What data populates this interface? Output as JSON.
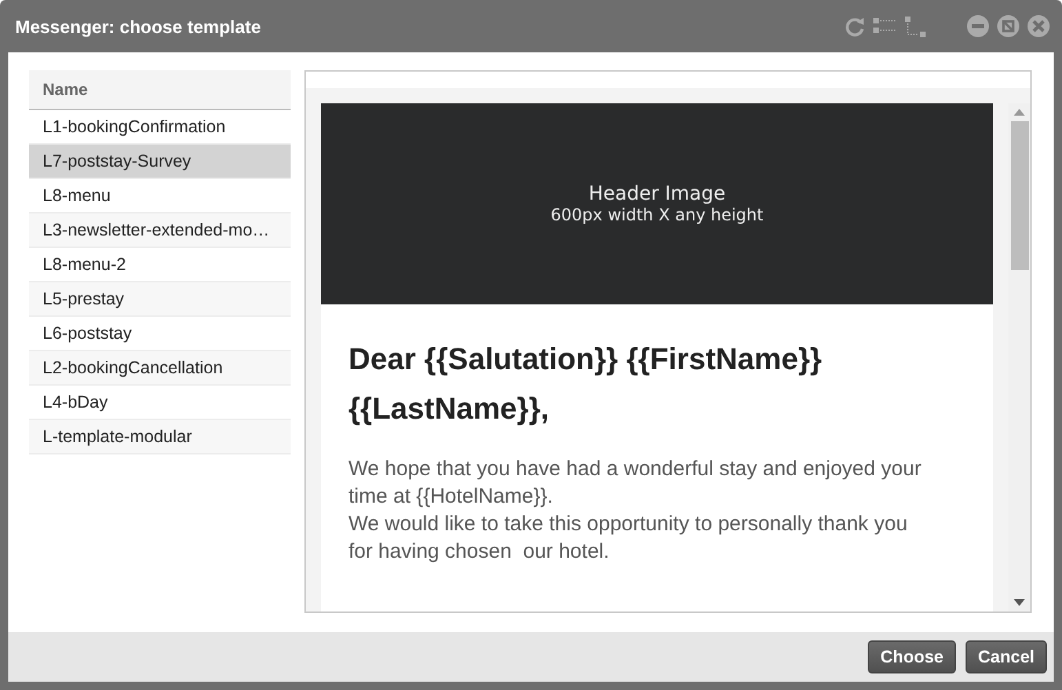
{
  "window": {
    "title": "Messenger: choose template"
  },
  "template_list": {
    "column": "Name",
    "items": [
      {
        "name": "L1-bookingConfirmation",
        "selected": false
      },
      {
        "name": "L7-poststay-Survey",
        "selected": true
      },
      {
        "name": "L8-menu",
        "selected": false
      },
      {
        "name": "L3-newsletter-extended-mo…",
        "selected": false
      },
      {
        "name": "L8-menu-2",
        "selected": false
      },
      {
        "name": "L5-prestay",
        "selected": false
      },
      {
        "name": "L6-poststay",
        "selected": false
      },
      {
        "name": "L2-bookingCancellation",
        "selected": false
      },
      {
        "name": "L4-bDay",
        "selected": false
      },
      {
        "name": "L-template-modular",
        "selected": false
      }
    ]
  },
  "preview": {
    "header_image": {
      "title": "Header Image",
      "subtitle": "600px width X any height"
    },
    "greeting": "Dear {{Salutation}} {{FirstName}} {{LastName}},",
    "paragraphs": [
      "We hope that you have had a wonderful stay and enjoyed your time at {{HotelName}}.",
      "We would like to take this opportunity to personally thank you for having chosen  our hotel."
    ]
  },
  "buttons": [
    "Choose",
    "Cancel"
  ]
}
